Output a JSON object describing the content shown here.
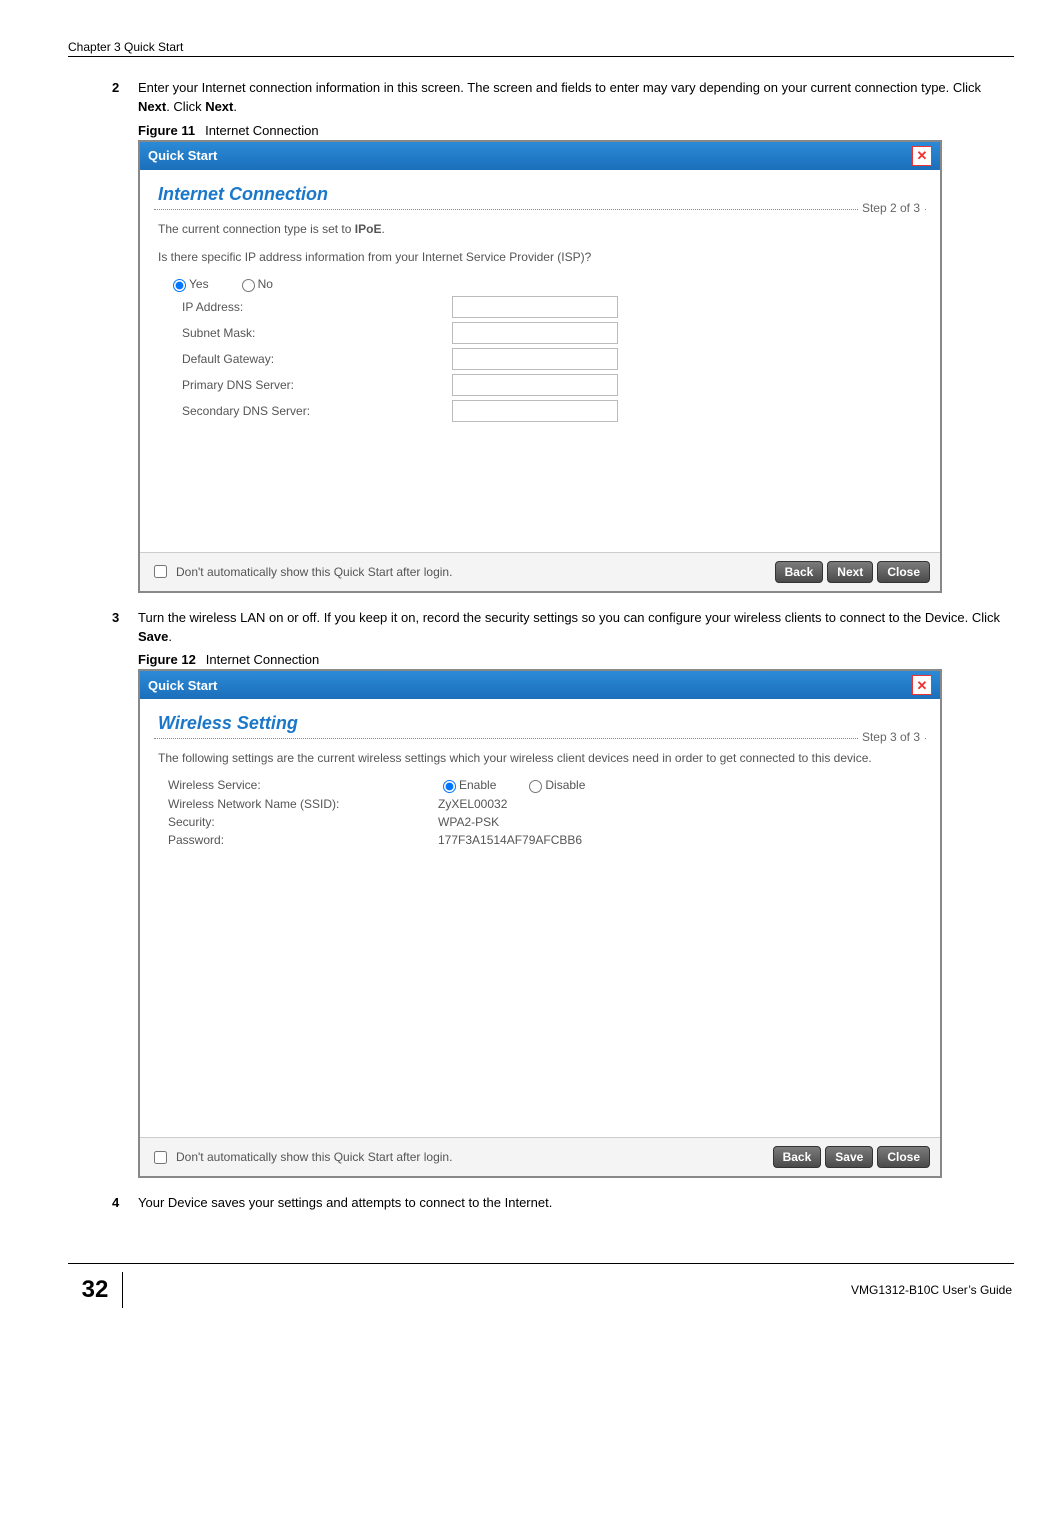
{
  "chapter_header": "Chapter 3 Quick Start",
  "step2": {
    "num": "2",
    "text_a": "Enter your Internet connection information in this screen. The screen and fields to enter may vary depending on your current connection type. Click ",
    "bold1": "Next",
    "text_b": ". Click ",
    "bold2": "Next",
    "text_c": "."
  },
  "figure11": {
    "num": "Figure 11",
    "title": "Internet Connection"
  },
  "dialog1": {
    "title": "Quick Start",
    "panel_title": "Internet Connection",
    "step_indicator": "Step 2 of 3",
    "desc_a": "The current connection type is set to ",
    "desc_bold": "IPoE",
    "desc_b": ".",
    "question": "Is there specific IP address information from your Internet Service Provider (ISP)?",
    "yes": "Yes",
    "no": "No",
    "fields": {
      "ip": "IP Address:",
      "mask": "Subnet Mask:",
      "gw": "Default Gateway:",
      "dns1": "Primary DNS Server:",
      "dns2": "Secondary DNS Server:"
    },
    "auto_show": "Don't automatically show this Quick Start after login.",
    "btn_back": "Back",
    "btn_next": "Next",
    "btn_close": "Close"
  },
  "step3": {
    "num": "3",
    "text_a": "Turn the wireless LAN on or off. If you keep it on, record the security settings so you can configure your wireless clients to connect to the Device. Click ",
    "bold1": "Save",
    "text_b": "."
  },
  "figure12": {
    "num": "Figure 12",
    "title": "Internet Connection"
  },
  "dialog2": {
    "title": "Quick Start",
    "panel_title": "Wireless Setting",
    "step_indicator": "Step 3 of 3",
    "desc": "The following settings are the current wireless settings which your wireless client devices need in order to get connected to this device.",
    "svc_label": "Wireless Service:",
    "enable": "Enable",
    "disable": "Disable",
    "ssid_label": "Wireless Network Name (SSID):",
    "ssid_value": "ZyXEL00032",
    "sec_label": "Security:",
    "sec_value": "WPA2-PSK",
    "pwd_label": "Password:",
    "pwd_value": "177F3A1514AF79AFCBB6",
    "auto_show": "Don't automatically show this Quick Start after login.",
    "btn_back": "Back",
    "btn_save": "Save",
    "btn_close": "Close"
  },
  "step4": {
    "num": "4",
    "text": "Your Device saves your settings and attempts to connect to the Internet."
  },
  "footer": {
    "page_num": "32",
    "guide": "VMG1312-B10C User’s Guide"
  }
}
